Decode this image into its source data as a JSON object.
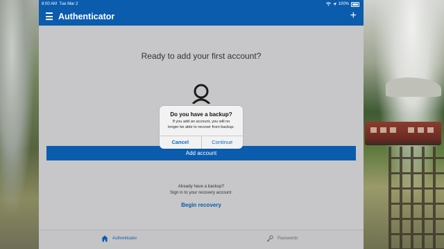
{
  "status_bar": {
    "time": "8:00 AM",
    "date": "Tue Mar 2",
    "battery_text": "100%",
    "icons": [
      "wifi-icon",
      "location-icon",
      "battery-icon"
    ]
  },
  "nav": {
    "title": "Authenticator",
    "menu_icon": "hamburger-menu-icon",
    "add_icon": "plus-icon"
  },
  "main": {
    "prompt": "Ready to add your first account?",
    "avatar_icon": "person-icon",
    "add_account_label": "Add account",
    "backup_line1": "Already have a backup?",
    "backup_line2": "Sign in to your recovery account.",
    "begin_recovery_label": "Begin recovery"
  },
  "dialog": {
    "title": "Do you have a backup?",
    "message_line1": "If you add an account, you will no",
    "message_line2": "longer be able to recover from backup.",
    "cancel_label": "Cancel",
    "continue_label": "Continue"
  },
  "tabs": [
    {
      "label": "Authenticator",
      "icon": "home-icon",
      "active": true
    },
    {
      "label": "Passwords",
      "icon": "key-icon",
      "active": false
    }
  ],
  "colors": {
    "brand_blue": "#0b5cad",
    "link_blue": "#0b66c3",
    "dim_background": "#c7c7c9"
  }
}
